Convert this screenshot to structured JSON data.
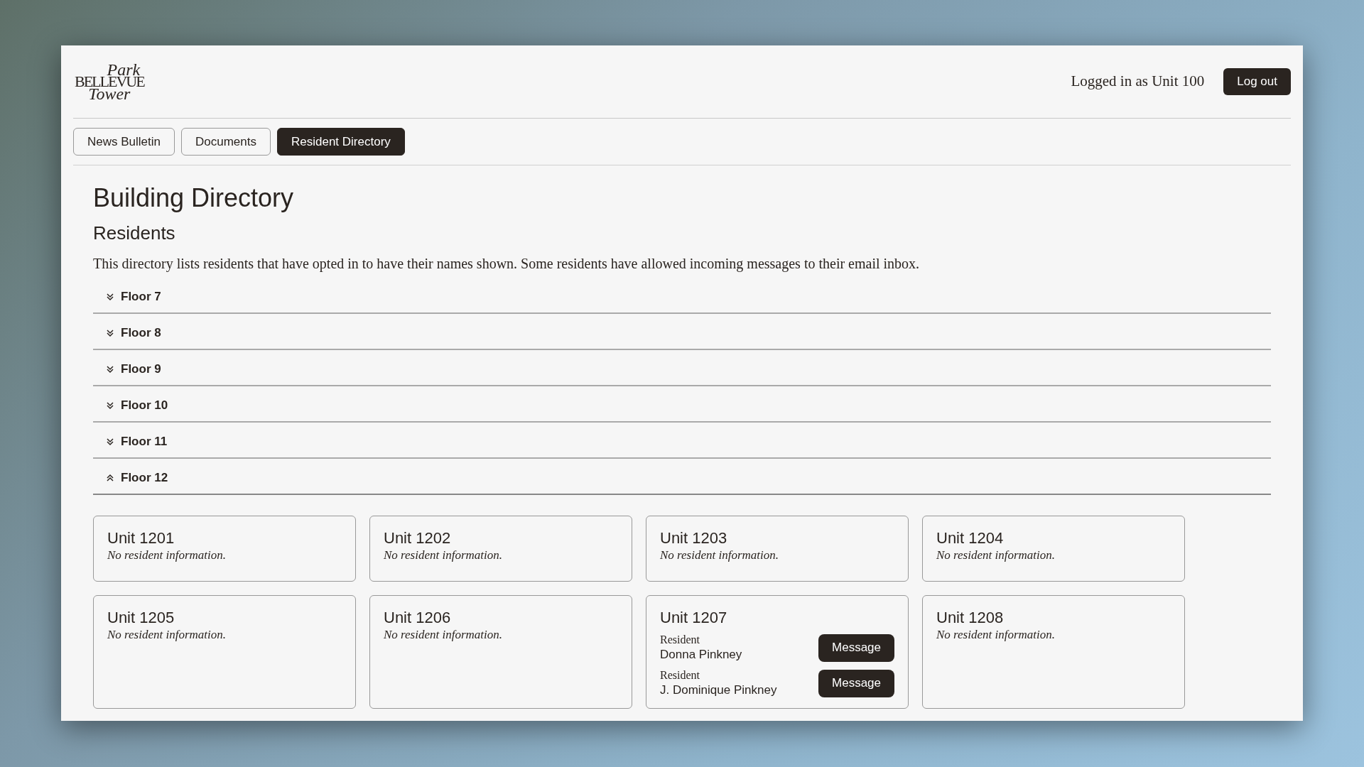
{
  "logo": {
    "line_1": "Park",
    "line_2": "BELLEVUE",
    "line_3": "Tower"
  },
  "header": {
    "login_status": "Logged in as Unit 100",
    "logout_button": "Log out"
  },
  "tabs": [
    {
      "label": "News Bulletin",
      "selected": false
    },
    {
      "label": "Documents",
      "selected": false
    },
    {
      "label": "Resident Directory",
      "selected": true
    }
  ],
  "title": "Building Directory",
  "subtitle": "Residents",
  "description": "This directory lists residents that have opted in to have their names shown. Some residents have allowed incoming messages to their email inbox.",
  "floors": [
    {
      "label": "Floor 7",
      "expanded": false
    },
    {
      "label": "Floor 8",
      "expanded": false
    },
    {
      "label": "Floor 9",
      "expanded": false
    },
    {
      "label": "Floor 10",
      "expanded": false
    },
    {
      "label": "Floor 11",
      "expanded": false
    },
    {
      "label": "Floor 12",
      "expanded": true
    }
  ],
  "units": [
    {
      "name": "Unit 1201",
      "empty_note": "No resident information."
    },
    {
      "name": "Unit 1202",
      "empty_note": "No resident information."
    },
    {
      "name": "Unit 1203",
      "empty_note": "No resident information."
    },
    {
      "name": "Unit 1204",
      "empty_note": "No resident information."
    },
    {
      "name": "Unit 1205",
      "empty_note": "No resident information."
    },
    {
      "name": "Unit 1206",
      "empty_note": "No resident information."
    },
    {
      "name": "Unit 1207",
      "residents": [
        {
          "role": "Resident",
          "name": "Donna Pinkney",
          "button": "Message"
        },
        {
          "role": "Resident",
          "name": "J. Dominique Pinkney",
          "button": "Message"
        }
      ]
    },
    {
      "name": "Unit 1208",
      "empty_note": "No resident information."
    }
  ]
}
